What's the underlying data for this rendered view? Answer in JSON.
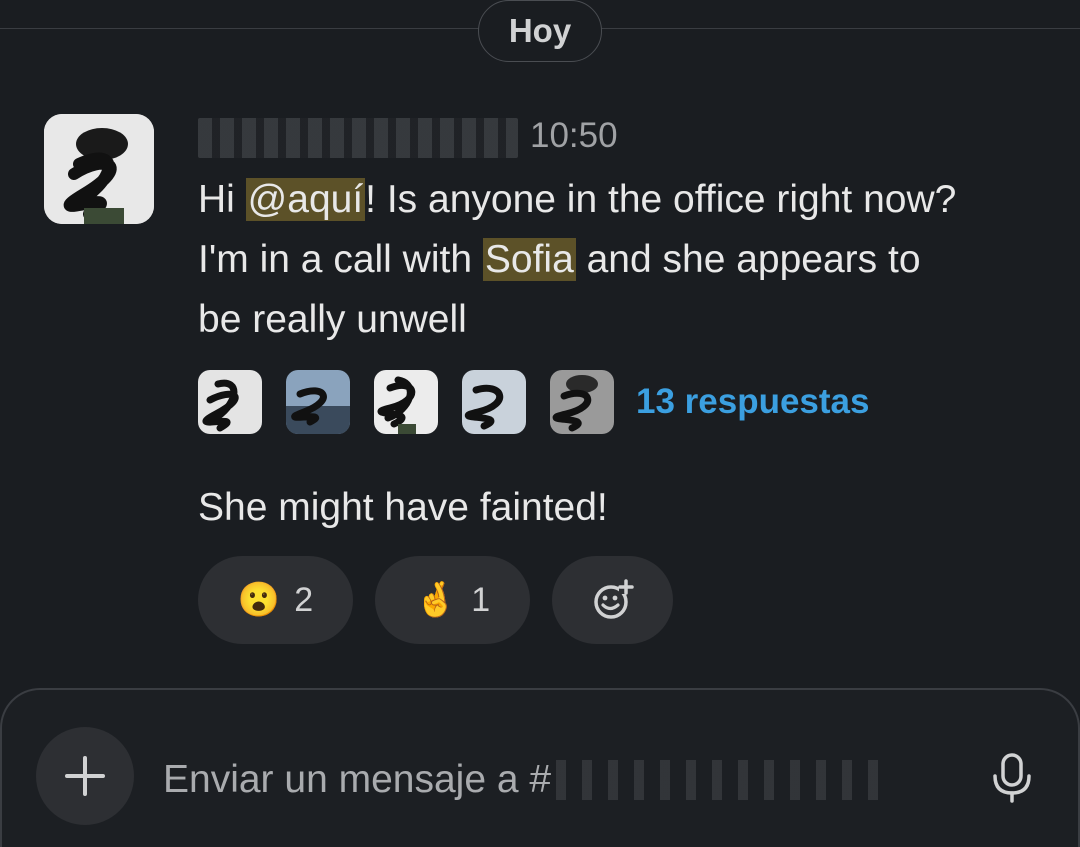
{
  "divider": {
    "day_label": "Hoy"
  },
  "message": {
    "time": "10:50",
    "text_part1": "Hi ",
    "mention1": "@aquí",
    "text_part2": "! Is anyone in the office right now? I'm in a call with ",
    "mention2": "Sofia",
    "text_part3": " and she appears to be really unwell",
    "thread": {
      "replies_label": "13 respuestas",
      "participant_count": 5
    },
    "followup": "She might have fainted!",
    "reactions": [
      {
        "icon": "astonished-face-icon",
        "emoji": "😮",
        "count": "2"
      },
      {
        "icon": "crossed-fingers-icon",
        "emoji": "🤞",
        "count": "1"
      }
    ],
    "add_reaction_icon": "add-reaction-icon"
  },
  "composer": {
    "placeholder": "Enviar un mensaje a #",
    "plus_icon": "plus-icon",
    "mic_icon": "microphone-icon"
  },
  "colors": {
    "background": "#1a1d21",
    "mention_bg": "#5c5128",
    "link": "#3b9fe0",
    "pill_bg": "#2d2f33"
  }
}
